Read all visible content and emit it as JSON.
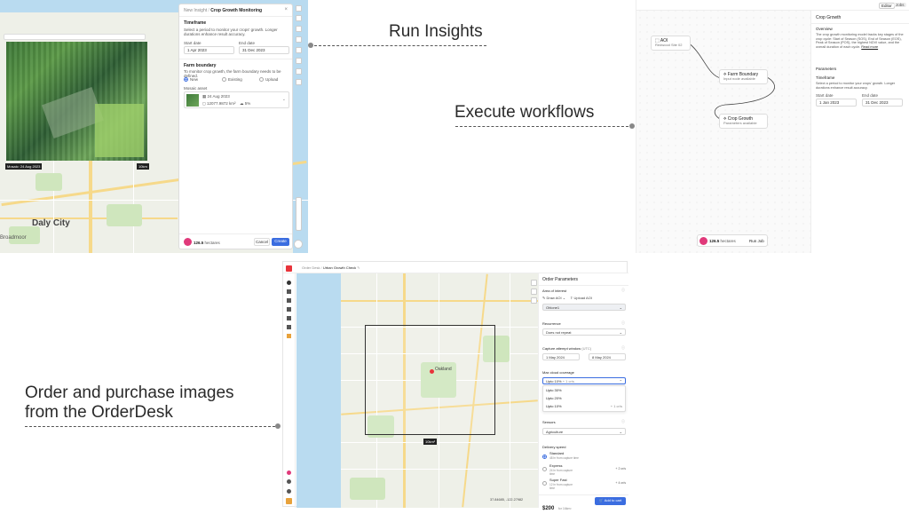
{
  "headlines": {
    "run_insights": "Run Insights",
    "execute_workflows": "Execute workflows",
    "orderdesk_line1": "Order and purchase images",
    "orderdesk_line2": "from the OrderDesk"
  },
  "insight_panel": {
    "breadcrumb_parent": "New Insight",
    "breadcrumb_current": "Crop Growth Monitoring",
    "timeframe_title": "Timeframe",
    "timeframe_desc": "Select a period to monitor your crops' growth. Longer durations enhance result accuracy.",
    "start_label": "Start date",
    "start_value": "1 Apr 2023",
    "end_label": "End date",
    "end_value": "31 Dec 2023",
    "farm_title": "Farm boundary",
    "farm_desc": "To monitor crop growth, the farm boundary needs to be defined.",
    "options": [
      "New",
      "Existing",
      "Upload"
    ],
    "mosaic_label": "Mosaic asset",
    "mosaic_date": "24 Aug 2023",
    "mosaic_area": "12077.9872 km²",
    "mosaic_cloud": "5%",
    "credits": "126.5",
    "credits_unit": "hectares",
    "cancel": "Cancel",
    "create": "Create",
    "image_date": "Mosaic: 24 Aug 2023",
    "scale": "10km"
  },
  "map_labels": {
    "daly_city": "Daly City",
    "broadmoor": "Broadmoor",
    "oakland": "Oakland"
  },
  "workflow": {
    "tabs": [
      "Editor",
      "Jobs"
    ],
    "aoi_title": "AOI",
    "aoi_sub": "Redwood Site 02",
    "farm_node": "Farm Boundary",
    "farm_sub": "Input node available",
    "crop_node": "Crop Growth",
    "crop_sub": "Parameters available",
    "side_title": "Crop Growth",
    "overview": "Overview",
    "overview_text": "The crop growth monitoring model tracks key stages of the crop cycle: Start of Season (SOS), End of Season (EOS), Peak of Season (POS), the highest NDVI value, and the overall duration of each cycle.",
    "read_more": "Read more",
    "parameters": "Parameters",
    "timeframe": "Timeframe",
    "timeframe_desc": "Select a period to monitor your crops' growth. Longer durations enhance result accuracy.",
    "start_label": "Start date",
    "start_value": "1 Jan 2023",
    "end_label": "End date",
    "end_value": "31 Dec 2023",
    "credits": "126.5",
    "credits_unit": "hectares",
    "run_job": "Run Job"
  },
  "orderdesk": {
    "breadcrumb_parent": "Order Desk",
    "breadcrumb_current": "Urban Growth Check",
    "panel_title": "Order Parameters",
    "aoi_label": "Area of interest",
    "draw_aoi": "Draw AOI",
    "upload_aoi": "Upload AOI",
    "aoi_value": "Ohlone1",
    "recurrence_label": "Recurrence",
    "recurrence_value": "Does not repeat",
    "capture_label": "Capture attempt window",
    "capture_unit": "(UTC)",
    "capture_start": "1 May 2024",
    "capture_end": "8 May 2024",
    "cloud_label": "Max cloud coverage",
    "cloud_value": "Upto 10%",
    "cloud_badge": "+ 1 cr/s",
    "cloud_options": [
      "Upto 30%",
      "Upto 20%",
      "Upto 10%"
    ],
    "cloud_option_badge": "+ 1 cr/s",
    "sensors_label": "Sensors",
    "sensors_value": "Agriculture",
    "delivery_label": "Delivery speed",
    "delivery": [
      {
        "name": "Standard",
        "desc": "48 hr from capture time",
        "price": ""
      },
      {
        "name": "Express",
        "desc": "24 hr from capture time",
        "price": "+ 2 cr/s"
      },
      {
        "name": "Super Fast",
        "desc": "12 hr from capture time",
        "price": "+ 4 cr/s"
      }
    ],
    "price": "$200",
    "price_unit": "for 16km²",
    "add_to_cart": "Add to cart",
    "coords": "37.84685, -122.27982",
    "area_badge": "10km²"
  },
  "colors": {
    "accent": "#3b6de0",
    "brand": "#e8343b",
    "pink": "#e0397a"
  }
}
